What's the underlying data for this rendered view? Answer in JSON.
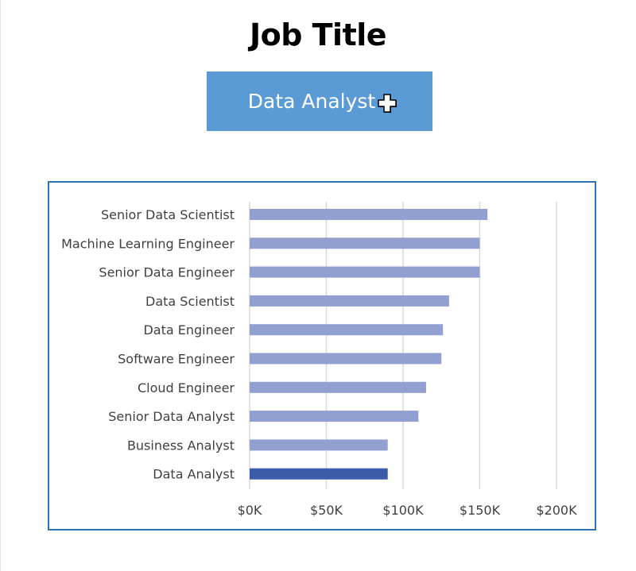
{
  "slicer": {
    "title": "Job Title",
    "selected": "Data Analyst"
  },
  "colors": {
    "bar": "#929fd1",
    "bar_selected": "#3a5ba8",
    "slicer_bg": "#5b9bd5",
    "frame": "#2e75b6",
    "grid": "#d9d9d9"
  },
  "chart_data": {
    "type": "bar",
    "orientation": "horizontal",
    "categories": [
      "Senior Data Scientist",
      "Machine Learning Engineer",
      "Senior Data Engineer",
      "Data Scientist",
      "Data Engineer",
      "Software Engineer",
      "Cloud Engineer",
      "Senior Data Analyst",
      "Business Analyst",
      "Data Analyst"
    ],
    "values": [
      155000,
      150000,
      150000,
      130000,
      126000,
      125000,
      115000,
      110000,
      90000,
      90000
    ],
    "highlighted": "Data Analyst",
    "xlim": [
      0,
      200000
    ],
    "xticks": [
      0,
      50000,
      100000,
      150000,
      200000
    ],
    "xtick_labels": [
      "$0K",
      "$50K",
      "$100K",
      "$150K",
      "$200K"
    ],
    "grid": true,
    "legend": false
  }
}
